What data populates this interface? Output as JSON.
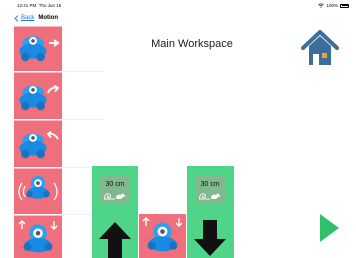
{
  "status_bar": {
    "time": "12:41 PM",
    "date": "Thu Jun 15",
    "battery_percent": "100%",
    "icons": [
      "wifi-icon",
      "battery-icon"
    ]
  },
  "nav": {
    "back_label": "Back",
    "title": "Motion"
  },
  "workspace": {
    "title": "Main Workspace"
  },
  "palette": {
    "items": [
      {
        "name": "move-forward-block",
        "icon": "dash-robot-move-forward-icon"
      },
      {
        "name": "turn-right-block",
        "icon": "dash-robot-turn-right-icon"
      },
      {
        "name": "turn-left-block",
        "icon": "dash-robot-turn-left-icon"
      },
      {
        "name": "spin-block",
        "icon": "dash-robot-spin-icon"
      },
      {
        "name": "move-up-down-block",
        "icon": "dash-robot-move-up-down-icon"
      }
    ]
  },
  "program": {
    "blocks": [
      {
        "type": "move",
        "distance": "30 cm",
        "speed_icon": "snail-rabbit-speed-icon",
        "direction": "up",
        "color": "#4fd58a"
      },
      {
        "type": "robot",
        "icon": "dash-robot-move-up-down-icon",
        "color": "#ef6f7d"
      },
      {
        "type": "move",
        "distance": "30 cm",
        "speed_icon": "snail-rabbit-speed-icon",
        "direction": "down",
        "color": "#4fd58a"
      }
    ]
  },
  "colors": {
    "accent_blue": "#1e78e6",
    "block_red": "#ef6f7d",
    "block_green": "#4fd58a",
    "home_blue": "#3b6f9a",
    "play_green": "#2fc06b"
  }
}
